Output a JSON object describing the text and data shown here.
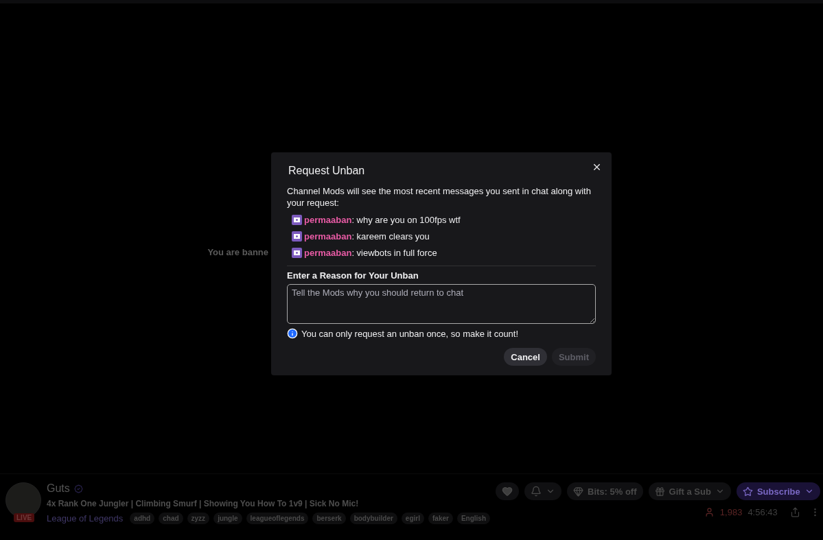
{
  "background_notice": "You are banne",
  "dialog": {
    "title": "Request Unban",
    "intro": "Channel Mods will see the most recent messages you sent in chat along with your request:",
    "messages": [
      {
        "user": "permaaban",
        "text": ": why are you on 100fps wtf"
      },
      {
        "user": "permaaban",
        "text": ": kareem clears you"
      },
      {
        "user": "permaaban",
        "text": ": viewbots in full force"
      }
    ],
    "reason_label": "Enter a Reason for Your Unban",
    "reason_placeholder": "Tell the Mods why you should return to chat",
    "info": "You can only request an unban once, so make it count!",
    "buttons": [
      {
        "label": "Cancel",
        "disabled": false
      },
      {
        "label": "Submit",
        "disabled": true
      }
    ]
  },
  "channel": {
    "name": "Guts",
    "live_badge": "LIVE",
    "title": "4x Rank One Jungler | Climbing Smurf | Showing You How To 1v9 | Sick No Mic!",
    "category": "League of Legends",
    "tags": [
      "adhd",
      "chad",
      "zyzz",
      "jungle",
      "leagueoflegends",
      "berserk",
      "bodybuilder",
      "egirl",
      "faker",
      "English"
    ],
    "actions": [
      {
        "kind": "heart"
      },
      {
        "kind": "bell"
      },
      {
        "kind": "bits",
        "label": "Bits: 5% off"
      },
      {
        "kind": "gift",
        "label": "Gift a Sub"
      },
      {
        "kind": "subscribe",
        "label": "Subscribe"
      }
    ],
    "viewers": "1,983",
    "uptime": "4:56:43"
  }
}
